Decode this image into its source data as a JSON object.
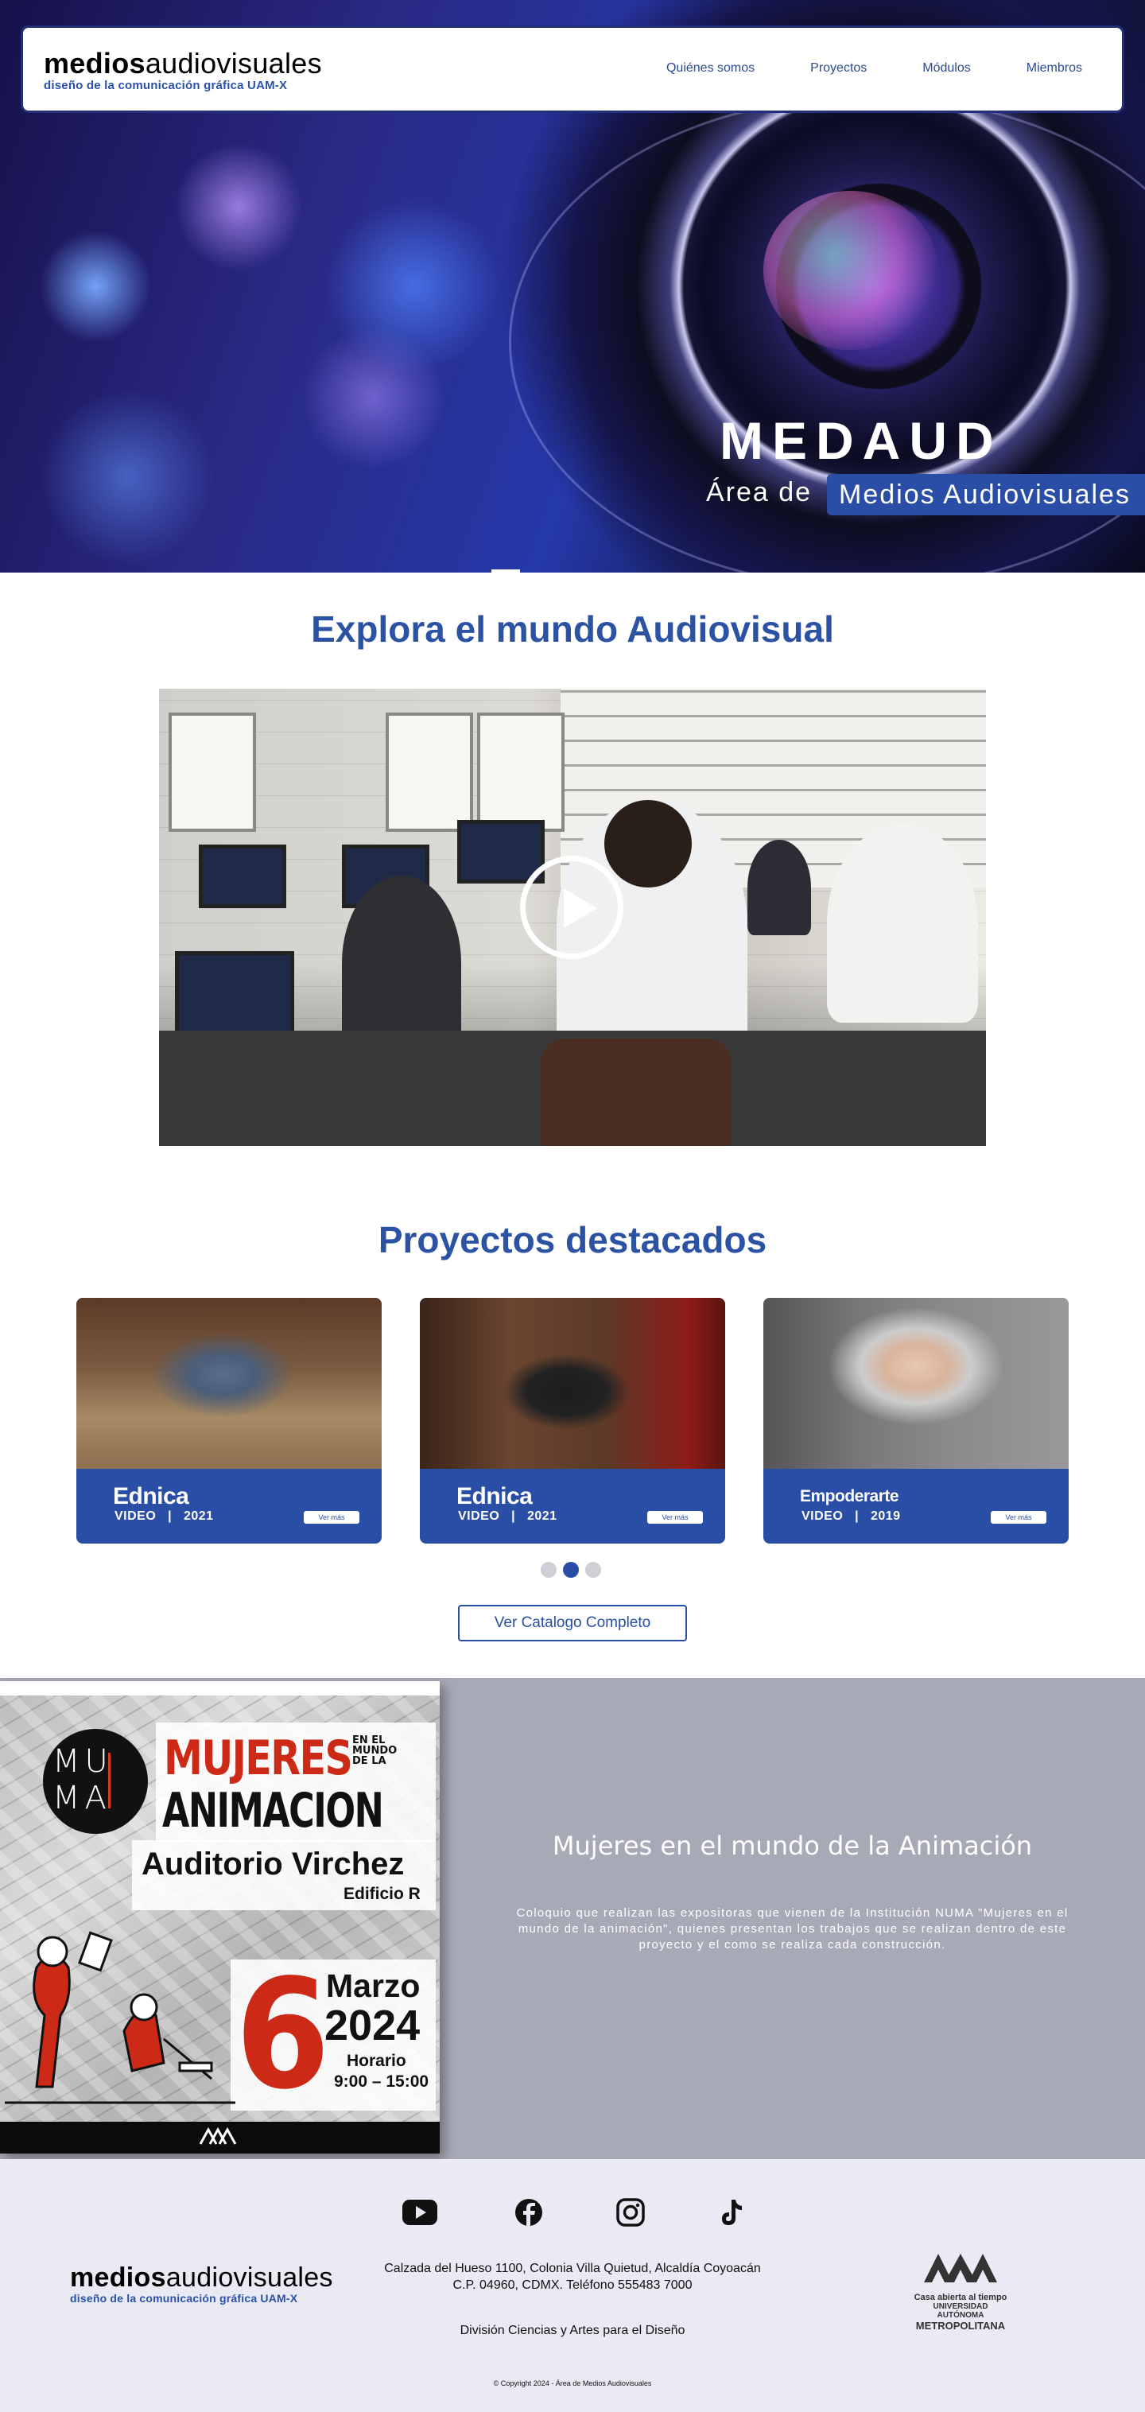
{
  "nav": {
    "logo_bold": "medios",
    "logo_light": "audiovisuales",
    "logo_sub": "diseño de la comunicación gráfica  UAM-X",
    "links": [
      "Quiénes somos",
      "Proyectos",
      "Módulos",
      "Miembros"
    ]
  },
  "hero": {
    "title": "MEDAUD",
    "subtitle_prefix": "Área de",
    "subtitle_box": "Medios Audiovisuales",
    "slide_indicator_active": 1
  },
  "explore": {
    "title": "Explora el mundo Audiovisual",
    "play_icon": "play-icon"
  },
  "projects": {
    "title": "Proyectos destacados",
    "cards": [
      {
        "title": "Ednica",
        "type": "VIDEO",
        "year": "2021",
        "button": "Ver más"
      },
      {
        "title": "Ednica",
        "type": "VIDEO",
        "year": "2021",
        "button": "Ver más"
      },
      {
        "title": "Empoderarte",
        "type": "VIDEO",
        "year": "2019",
        "button": "Ver más"
      }
    ],
    "carousel_active": 2,
    "catalog_button": "Ver Catalogo Completo"
  },
  "event": {
    "poster": {
      "circle_text_top": "MU",
      "circle_text_bottom": "MA",
      "headline": "MUJERES",
      "headline_small": [
        "EN EL",
        "MUNDO",
        "DE LA"
      ],
      "headline2": "ANIMACION",
      "venue": "Auditorio Virchez",
      "building": "Edificio R",
      "day": "6",
      "month": "Marzo",
      "year": "2024",
      "schedule_label": "Horario",
      "schedule": "9:00 – 15:00"
    },
    "title": "Mujeres en el mundo de la Animación",
    "description": "Coloquio que realizan las expositoras que vienen de la Institución NUMA \"Mujeres en el mundo de la animación\", quienes presentan los trabajos que se realizan dentro de este proyecto y el como se realiza cada construcción."
  },
  "footer": {
    "social_icons": [
      "youtube-icon",
      "facebook-icon",
      "instagram-icon",
      "tiktok-icon"
    ],
    "logo_bold": "medios",
    "logo_light": "audiovisuales",
    "logo_sub": "diseño de la comunicación gráfica  UAM-X",
    "address_line1": "Calzada del Hueso 1100, Colonia Villa Quietud, Alcaldía Coyoacán",
    "address_line2": "C.P. 04960, CDMX. Teléfono 555483 7000",
    "division": "División Ciencias y Artes para el Diseño",
    "copyright": "© Copyright 2024 - Área de Medios Audiovisuales",
    "uam_line1": "Casa abierta al tiempo",
    "uam_line2": "UNIVERSIDAD AUTÓNOMA",
    "uam_line3": "METROPOLITANA"
  },
  "colors": {
    "brand_blue": "#2a4ea6",
    "title_blue": "#2b52a3",
    "event_grey": "#a8a9b6",
    "footer_bg": "#e9eaf3",
    "poster_red": "#cc2a17"
  }
}
